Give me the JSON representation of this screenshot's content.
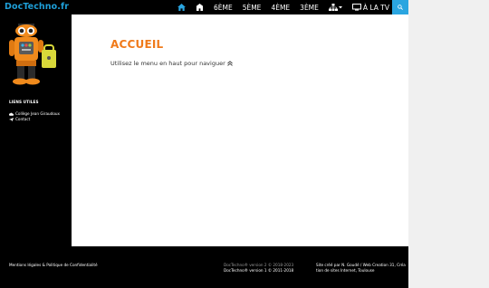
{
  "site": {
    "brand": "DocTechno.fr"
  },
  "nav": {
    "items": [
      {
        "label": "6ÈME"
      },
      {
        "label": "5ÈME"
      },
      {
        "label": "4ÈME"
      },
      {
        "label": "3ÈME"
      }
    ],
    "tv_label": "À LA TV"
  },
  "sidebar": {
    "section_title": "LIENS UTILES",
    "links": [
      {
        "label": "Collège Jean Giraudoux"
      },
      {
        "label": "Contact"
      }
    ]
  },
  "main": {
    "title": "ACCUEIL",
    "text": "Utilisez le menu en haut pour naviguer"
  },
  "footer": {
    "legal": "Mentions légales & Politique de Confidentialité",
    "version_line1": "DocTechno® version 2 © 2018-2023",
    "version_line2": "DocTechno® version 1 © 2011-2018",
    "credit_line1": "Site créé par N. Goudé / Web Creation 31, Créa",
    "credit_line2": "tion de sites Internet, Toulouse"
  },
  "colors": {
    "accent": "#2aa5e0",
    "title": "#f07a1a",
    "bar": "#000000"
  }
}
